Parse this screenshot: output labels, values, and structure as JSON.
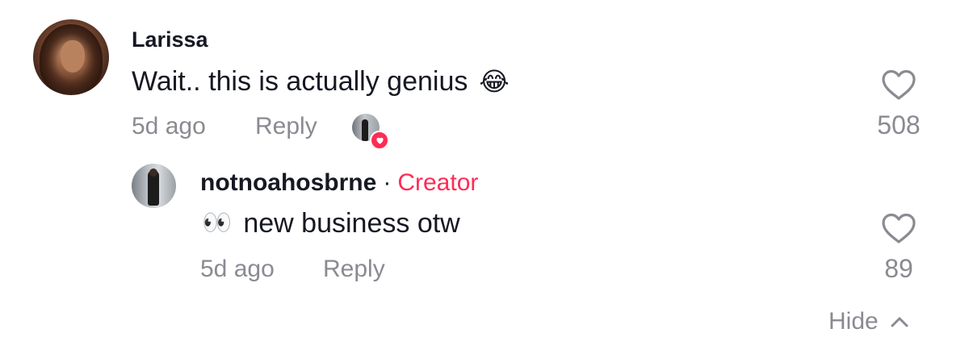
{
  "comment": {
    "username": "Larissa",
    "text": "Wait.. this is actually genius",
    "emoji": "😂",
    "time": "5d ago",
    "reply_label": "Reply",
    "like_count": "508"
  },
  "reply": {
    "username": "notnoahosbrne",
    "separator": "·",
    "creator_label": "Creator",
    "emoji": "👀",
    "text": "new business otw",
    "time": "5d ago",
    "reply_label": "Reply",
    "like_count": "89"
  },
  "thread": {
    "hide_label": "Hide"
  },
  "colors": {
    "accent": "#fe2c55",
    "text": "#161823",
    "muted": "#8a8b91"
  },
  "icons": {
    "like": "heart-outline-icon",
    "collapse": "chevron-up-icon",
    "creator_liked": "heart-badge-icon"
  }
}
